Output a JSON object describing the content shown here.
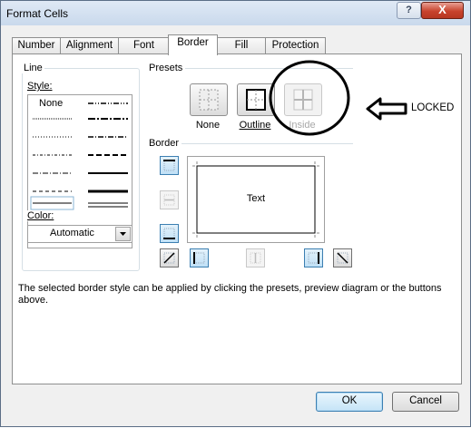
{
  "window": {
    "title": "Format Cells",
    "help": "?",
    "close": "X"
  },
  "tabs": [
    {
      "label": "Number"
    },
    {
      "label": "Alignment"
    },
    {
      "label": "Font"
    },
    {
      "label": "Border"
    },
    {
      "label": "Fill"
    },
    {
      "label": "Protection"
    }
  ],
  "line": {
    "group_label": "Line",
    "style_label": "Style:",
    "none_label": "None",
    "color_label": "Color:",
    "color_value": "Automatic"
  },
  "presets": {
    "group_label": "Presets",
    "none_label": "None",
    "outline_label": "Outline",
    "inside_label": "Inside"
  },
  "border": {
    "group_label": "Border",
    "preview_text": "Text"
  },
  "help_text": "The selected border style can be applied by clicking the presets, preview diagram or the buttons above.",
  "annotation": {
    "text": "LOCKED"
  },
  "footer": {
    "ok": "OK",
    "cancel": "Cancel"
  },
  "colors": {
    "accent": "#3c7fb1",
    "close": "#c8432d",
    "titlebar": "#c9d9ec"
  }
}
